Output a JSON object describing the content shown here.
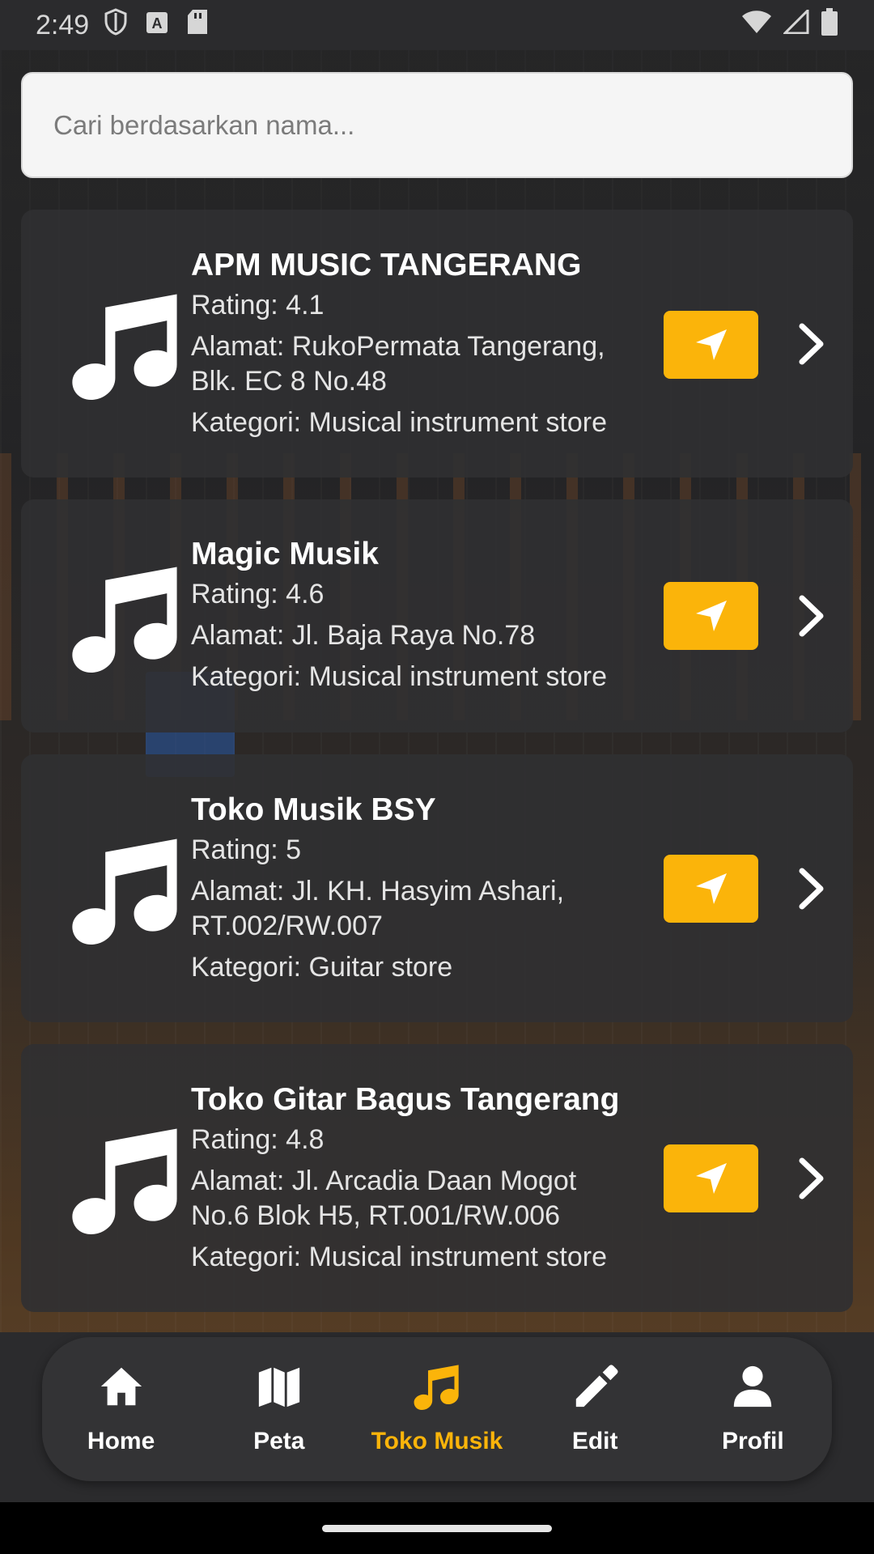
{
  "status_bar": {
    "time": "2:49",
    "icons_left": [
      "shield-icon",
      "a-icon",
      "sd-card-icon"
    ],
    "icons_right": [
      "wifi-icon",
      "cell-signal-icon",
      "battery-icon"
    ]
  },
  "search": {
    "placeholder": "Cari berdasarkan nama...",
    "value": ""
  },
  "stores": [
    {
      "name": "APM MUSIC TANGERANG",
      "rating": "Rating: 4.1",
      "address_line1": "Alamat: RukoPermata Tangerang,",
      "address_line2": "Blk. EC 8 No.48",
      "category": "Kategori: Musical instrument store"
    },
    {
      "name": "Magic Musik",
      "rating": "Rating: 4.6",
      "address_line1": "Alamat: Jl. Baja Raya No.78",
      "address_line2": "",
      "category": "Kategori: Musical instrument store"
    },
    {
      "name": "Toko Musik BSY",
      "rating": "Rating: 5",
      "address_line1": "Alamat: Jl. KH. Hasyim Ashari,",
      "address_line2": "RT.002/RW.007",
      "category": "Kategori: Guitar store"
    },
    {
      "name": "Toko Gitar Bagus Tangerang",
      "rating": "Rating: 4.8",
      "address_line1": "Alamat: Jl. Arcadia Daan Mogot",
      "address_line2": "No.6 Blok H5, RT.001/RW.006",
      "category": "Kategori: Musical instrument store"
    }
  ],
  "bottom_nav": {
    "active": "Toko Musik",
    "accent_color": "#fbb40a",
    "items": [
      {
        "label": "Home",
        "icon": "home-icon"
      },
      {
        "label": "Peta",
        "icon": "map-icon"
      },
      {
        "label": "Toko Musik",
        "icon": "music-note-icon"
      },
      {
        "label": "Edit",
        "icon": "pencil-icon"
      },
      {
        "label": "Profil",
        "icon": "person-icon"
      }
    ]
  }
}
